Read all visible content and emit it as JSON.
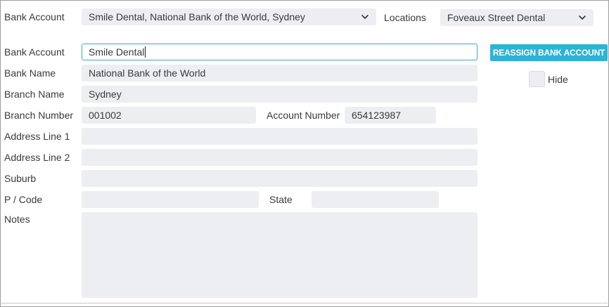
{
  "header": {
    "bank_account_label": "Bank Account",
    "bank_account_selected": "Smile Dental, National Bank of the World, Sydney",
    "locations_label": "Locations",
    "location_selected": "Foveaux Street Dental"
  },
  "form": {
    "bank_account_label": "Bank Account",
    "bank_account_value": "Smile Dental",
    "bank_name_label": "Bank Name",
    "bank_name_value": "National Bank of the World",
    "branch_name_label": "Branch Name",
    "branch_name_value": "Sydney",
    "branch_number_label": "Branch Number",
    "branch_number_value": "001002",
    "account_number_label": "Account Number",
    "account_number_value": "654123987",
    "address_line1_label": "Address Line 1",
    "address_line1_value": "",
    "address_line2_label": "Address Line 2",
    "address_line2_value": "",
    "suburb_label": "Suburb",
    "suburb_value": "",
    "postcode_label": "P / Code",
    "postcode_value": "",
    "state_label": "State",
    "state_value": "",
    "notes_label": "Notes",
    "notes_value": ""
  },
  "actions": {
    "reassign_label": "REASSIGN BANK ACCOUNT",
    "hide_label": "Hide",
    "hide_checked": false
  },
  "icons": {
    "dropdown": "chevron-down-icon"
  },
  "colors": {
    "accent": "#2bb4d6",
    "field_bg": "#eceef2",
    "focus_border": "#37a9c4"
  }
}
